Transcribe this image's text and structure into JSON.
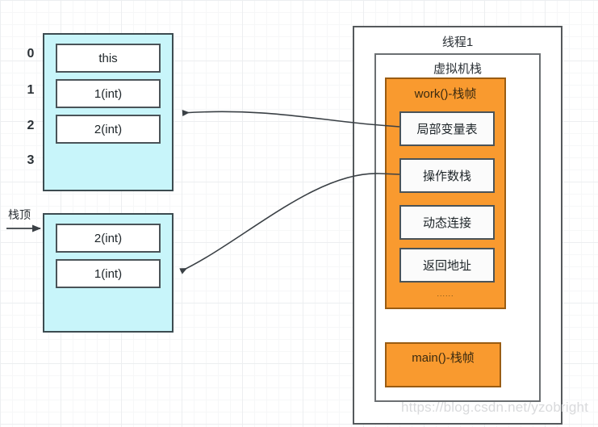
{
  "diagram": {
    "title_watermark": "https://blog.csdn.net/yzobright",
    "colors": {
      "cyan_fill": "#c8f5fa",
      "orange_fill": "#f99a2f",
      "panel_border": "#55595c",
      "slot_border": "#4a5358",
      "grid_minor": "#f6f7f8",
      "grid_major": "#eceef0"
    },
    "local_variable_table": {
      "caption": "栈顶",
      "indexes": [
        "0",
        "1",
        "2",
        "3"
      ],
      "slots": [
        {
          "label": "this"
        },
        {
          "label": "1(int)"
        },
        {
          "label": "2(int)"
        }
      ]
    },
    "operand_stack": {
      "caption": "栈顶",
      "slots": [
        {
          "label": "2(int)"
        },
        {
          "label": "1(int)"
        }
      ]
    },
    "thread": {
      "title": "线程1",
      "vm_stack": {
        "title": "虚拟机栈",
        "frames": [
          {
            "title": "work()-栈帧",
            "parts": [
              {
                "label": "局部变量表"
              },
              {
                "label": "操作数栈"
              },
              {
                "label": "动态连接"
              },
              {
                "label": "返回地址"
              }
            ],
            "ellipsis": "......"
          },
          {
            "title": "main()-栈帧",
            "parts": []
          }
        ]
      }
    },
    "connectors": [
      {
        "from": "局部变量表",
        "to": "local-variable-table-box"
      },
      {
        "from": "操作数栈",
        "to": "operand-stack-box"
      }
    ]
  }
}
